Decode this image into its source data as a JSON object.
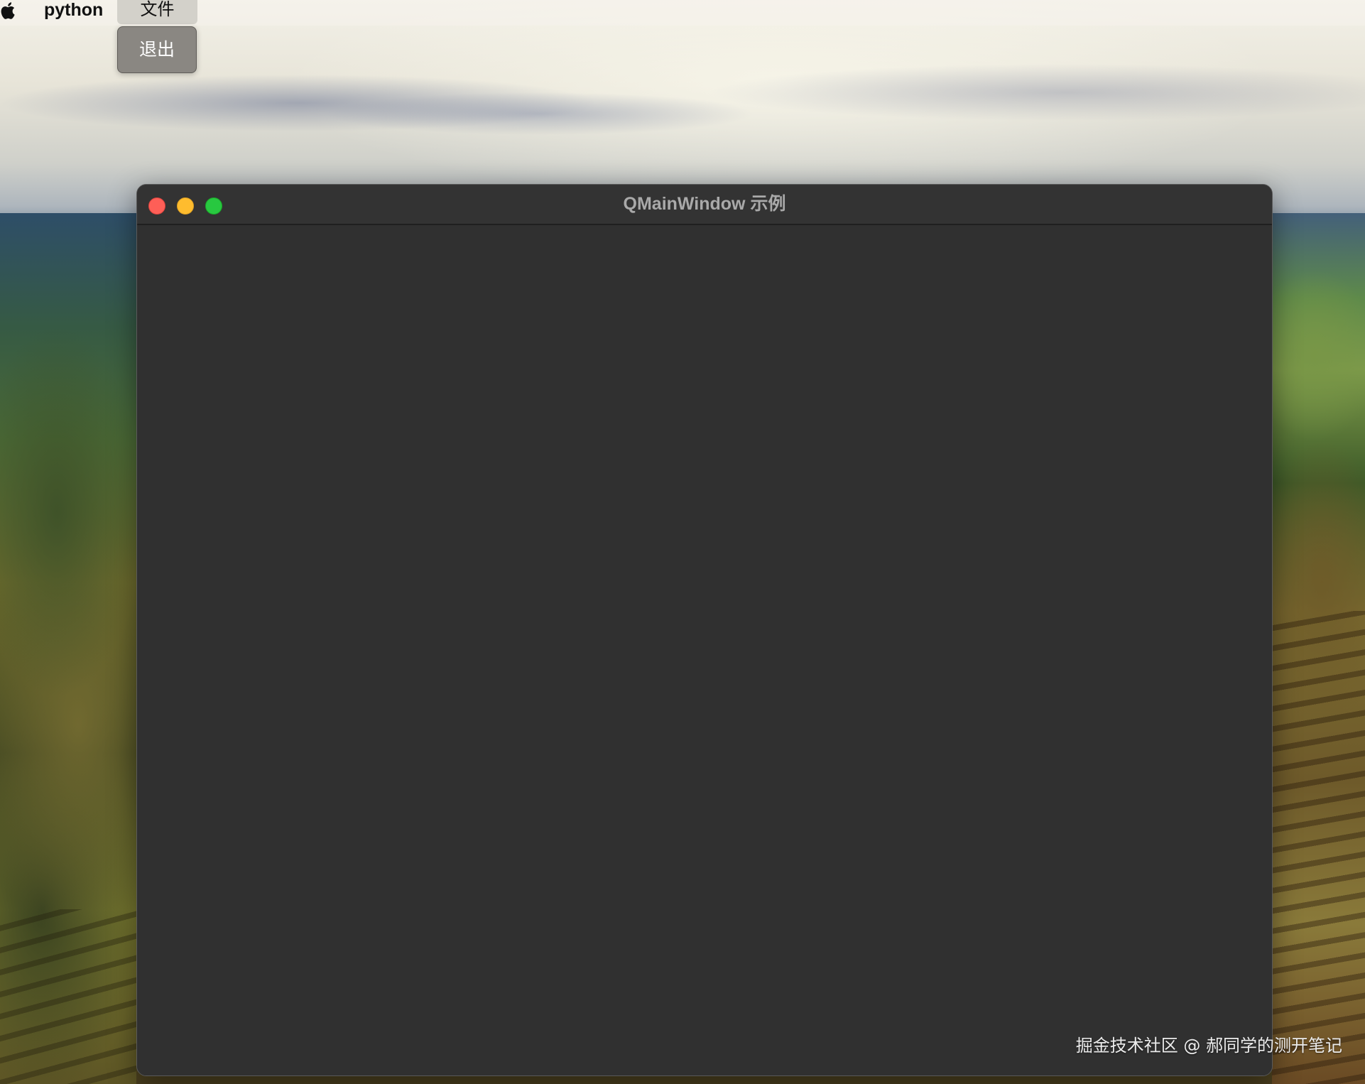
{
  "menubar": {
    "apple_icon": "apple-logo-icon",
    "app_name": "python",
    "menus": [
      {
        "label": "文件",
        "open": true
      }
    ]
  },
  "dropdown": {
    "items": [
      {
        "label": "退出"
      }
    ]
  },
  "window": {
    "title": "QMainWindow 示例",
    "controls": {
      "close_color": "#fe5f57",
      "minimize_color": "#febc2e",
      "maximize_color": "#28c840"
    },
    "background_color": "#303030"
  },
  "watermark": {
    "text": "掘金技术社区 @ 郝同学的测开笔记"
  }
}
